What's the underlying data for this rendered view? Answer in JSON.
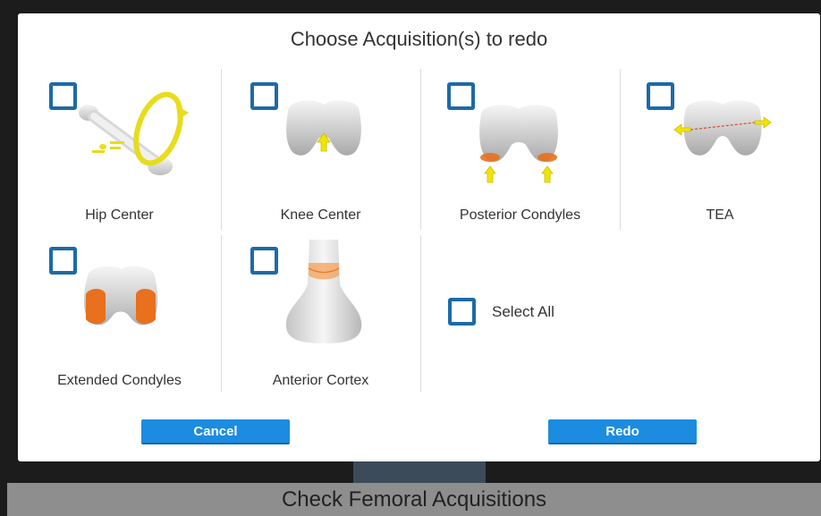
{
  "screen": {
    "footer_title": "Check Femoral Acquisitions"
  },
  "dialog": {
    "title": "Choose Acquisition(s) to redo",
    "options": [
      {
        "label": "Hip Center",
        "checked": false,
        "illustration": "hip-center-illustration"
      },
      {
        "label": "Knee Center",
        "checked": false,
        "illustration": "knee-center-illustration"
      },
      {
        "label": "Posterior Condyles",
        "checked": false,
        "illustration": "posterior-condyles-illustration"
      },
      {
        "label": "TEA",
        "checked": false,
        "illustration": "tea-illustration"
      },
      {
        "label": "Extended Condyles",
        "checked": false,
        "illustration": "extended-condyles-illustration"
      },
      {
        "label": "Anterior Cortex",
        "checked": false,
        "illustration": "anterior-cortex-illustration"
      }
    ],
    "select_all": {
      "label": "Select All",
      "checked": false
    },
    "buttons": {
      "cancel": "Cancel",
      "redo": "Redo"
    }
  },
  "colors": {
    "checkbox_border": "#1d6aa7",
    "button_fill": "#1b8ce0",
    "condyle_highlight": "#e8701e",
    "arrow_yellow": "#f2e400"
  }
}
